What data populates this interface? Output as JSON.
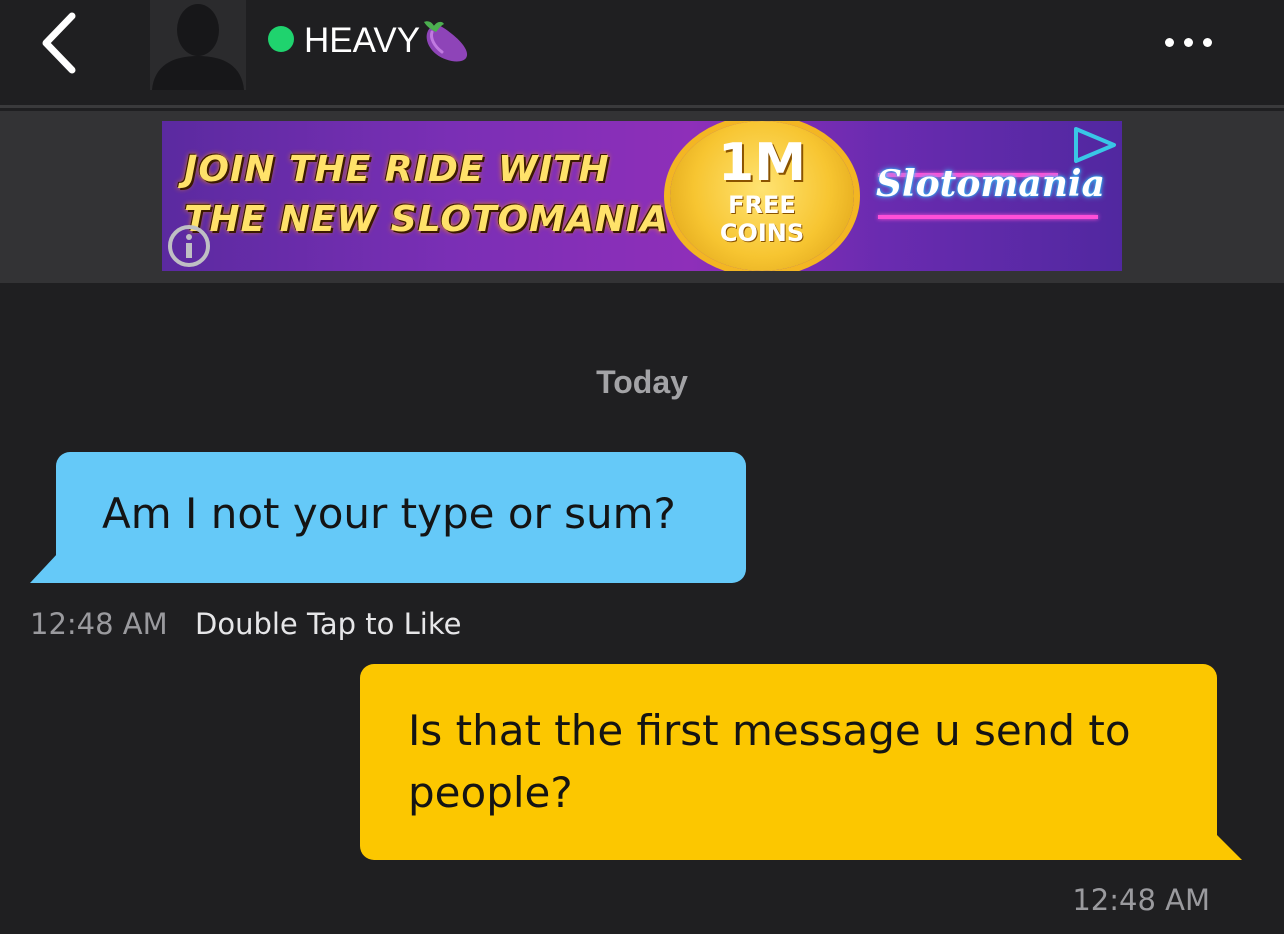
{
  "header": {
    "username": "HEAVY",
    "username_emoji": "eggplant-emoji",
    "online": true,
    "online_color": "#1fd36e",
    "back_icon": "chevron-left-icon",
    "more_icon": "more-horizontal-icon"
  },
  "ad": {
    "headline_line1": "JOIN THE RIDE WITH",
    "headline_line2": "THE NEW SLOTOMANIA",
    "coin_big": "1M",
    "coin_line1": "FREE",
    "coin_line2": "COINS",
    "brand": "Slotomania",
    "play_icon": "ad-choices-play-icon",
    "info_icon": "info-icon"
  },
  "chat": {
    "date_label": "Today",
    "messages": [
      {
        "direction": "received",
        "text": "Am I not your type or sum?",
        "time": "12:48 AM",
        "hint": "Double Tap to Like",
        "bubble_color": "#65c9f8"
      },
      {
        "direction": "sent",
        "text": "Is that the first message u send to people?",
        "time": "12:48 AM",
        "bubble_color": "#fcc700"
      }
    ]
  }
}
